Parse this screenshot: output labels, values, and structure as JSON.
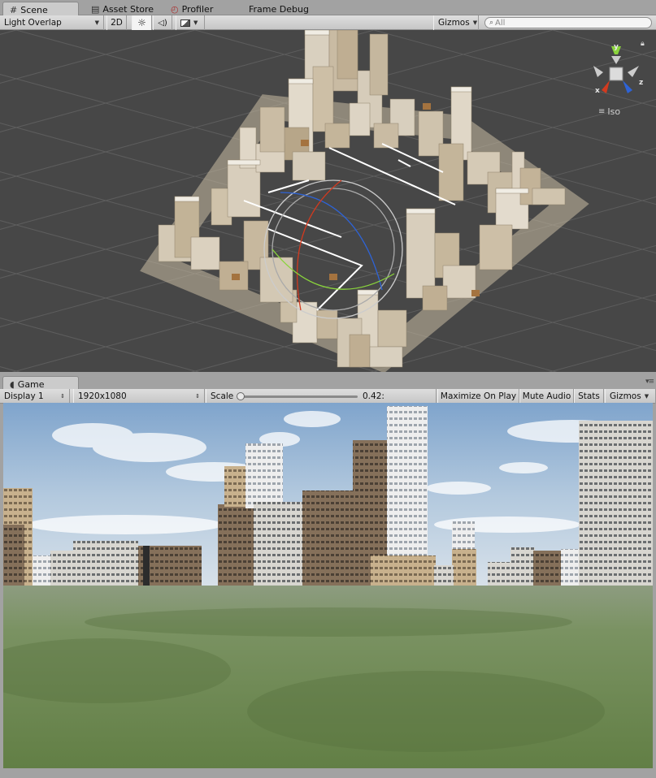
{
  "scene_panel": {
    "tabs": [
      {
        "label": "Scene",
        "icon": "grid-icon"
      },
      {
        "label": "Asset Store",
        "icon": "store-icon"
      },
      {
        "label": "Profiler",
        "icon": "profiler-icon"
      },
      {
        "label": "Frame Debug",
        "icon": ""
      }
    ],
    "toolbar": {
      "draw_mode": "Light Overlap",
      "mode_2d": "2D",
      "gizmos": "Gizmos",
      "search_placeholder": "All"
    },
    "gizmo_axes": {
      "x": "x",
      "y": "y",
      "z": "z"
    },
    "projection_label": "Iso"
  },
  "game_panel": {
    "tab_label": "Game",
    "toolbar": {
      "display": "Display 1",
      "resolution": "1920x1080",
      "scale_label": "Scale",
      "scale_value": "0.42:",
      "scale_fraction": 0.03,
      "maximize_on_play": "Maximize On Play",
      "mute_audio": "Mute Audio",
      "stats": "Stats",
      "gizmos": "Gizmos"
    }
  },
  "colors": {
    "scene_bg": "#474747",
    "grid_line": "#5a5a5a",
    "building": "#c9bba3",
    "axis_x": "#d23a1f",
    "axis_y": "#8ad43c",
    "axis_z": "#2e63d6",
    "sky_top": "#7fa3c9",
    "grass": "#6e8454"
  }
}
